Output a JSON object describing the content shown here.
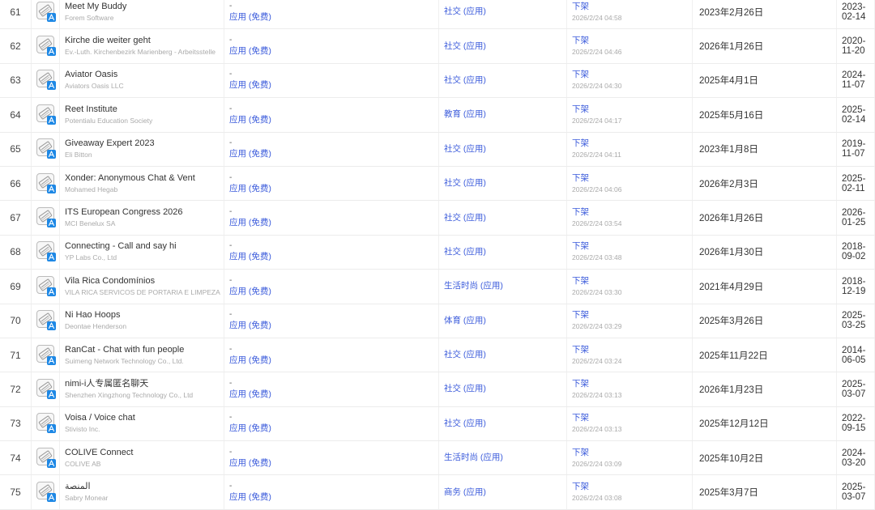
{
  "rows": [
    {
      "rank": "61",
      "name": "Meet My Buddy",
      "developer": "Forem Software",
      "price_dash": "-",
      "price": "应用 (免费)",
      "category": "社交 (应用)",
      "status": "下架",
      "status_time": "2026/2/24 04:58",
      "last_update": "2023年2月26日",
      "release_date": "2023-02-14"
    },
    {
      "rank": "62",
      "name": "Kirche die weiter geht",
      "developer": "Ev.-Luth. Kirchenbezirk Marienberg - Arbeitsstelle",
      "price_dash": "-",
      "price": "应用 (免费)",
      "category": "社交 (应用)",
      "status": "下架",
      "status_time": "2026/2/24 04:46",
      "last_update": "2026年1月26日",
      "release_date": "2020-11-20"
    },
    {
      "rank": "63",
      "name": "Aviator Oasis",
      "developer": "Aviators Oasis LLC",
      "price_dash": "-",
      "price": "应用 (免费)",
      "category": "社交 (应用)",
      "status": "下架",
      "status_time": "2026/2/24 04:30",
      "last_update": "2025年4月1日",
      "release_date": "2024-11-07"
    },
    {
      "rank": "64",
      "name": "Reet Institute",
      "developer": "Potentialu Education Society",
      "price_dash": "-",
      "price": "应用 (免费)",
      "category": "教育 (应用)",
      "status": "下架",
      "status_time": "2026/2/24 04:17",
      "last_update": "2025年5月16日",
      "release_date": "2025-02-14"
    },
    {
      "rank": "65",
      "name": "Giveaway Expert 2023",
      "developer": "Eli Bitton",
      "price_dash": "-",
      "price": "应用 (免费)",
      "category": "社交 (应用)",
      "status": "下架",
      "status_time": "2026/2/24 04:11",
      "last_update": "2023年1月8日",
      "release_date": "2019-11-07"
    },
    {
      "rank": "66",
      "name": "Xonder: Anonymous Chat & Vent",
      "developer": "Mohamed Hegab",
      "price_dash": "-",
      "price": "应用 (免费)",
      "category": "社交 (应用)",
      "status": "下架",
      "status_time": "2026/2/24 04:06",
      "last_update": "2026年2月3日",
      "release_date": "2025-02-11"
    },
    {
      "rank": "67",
      "name": "ITS European Congress 2026",
      "developer": "MCI Benelux SA",
      "price_dash": "-",
      "price": "应用 (免费)",
      "category": "社交 (应用)",
      "status": "下架",
      "status_time": "2026/2/24 03:54",
      "last_update": "2026年1月26日",
      "release_date": "2026-01-25"
    },
    {
      "rank": "68",
      "name": "Connecting - Call and say hi",
      "developer": "YP Labs Co., Ltd",
      "price_dash": "-",
      "price": "应用 (免费)",
      "category": "社交 (应用)",
      "status": "下架",
      "status_time": "2026/2/24 03:48",
      "last_update": "2026年1月30日",
      "release_date": "2018-09-02"
    },
    {
      "rank": "69",
      "name": "Vila Rica Condomínios",
      "developer": "VILA RICA SERVICOS DE PORTARIA E LIMPEZA",
      "price_dash": "-",
      "price": "应用 (免费)",
      "category": "生活时尚 (应用)",
      "status": "下架",
      "status_time": "2026/2/24 03:30",
      "last_update": "2021年4月29日",
      "release_date": "2018-12-19"
    },
    {
      "rank": "70",
      "name": "Ni Hao Hoops",
      "developer": "Deontae Henderson",
      "price_dash": "-",
      "price": "应用 (免费)",
      "category": "体育 (应用)",
      "status": "下架",
      "status_time": "2026/2/24 03:29",
      "last_update": "2025年3月26日",
      "release_date": "2025-03-25"
    },
    {
      "rank": "71",
      "name": "RanCat - Chat with fun people",
      "developer": "Suimeng Network Technology Co., Ltd.",
      "price_dash": "-",
      "price": "应用 (免费)",
      "category": "社交 (应用)",
      "status": "下架",
      "status_time": "2026/2/24 03:24",
      "last_update": "2025年11月22日",
      "release_date": "2014-06-05"
    },
    {
      "rank": "72",
      "name": "nimi-i人专属匿名聊天",
      "developer": "Shenzhen Xingzhong Technology Co., Ltd",
      "price_dash": "-",
      "price": "应用 (免费)",
      "category": "社交 (应用)",
      "status": "下架",
      "status_time": "2026/2/24 03:13",
      "last_update": "2026年1月23日",
      "release_date": "2025-03-07"
    },
    {
      "rank": "73",
      "name": "Voisa / Voice chat",
      "developer": "Stivisto Inc.",
      "price_dash": "-",
      "price": "应用 (免费)",
      "category": "社交 (应用)",
      "status": "下架",
      "status_time": "2026/2/24 03:13",
      "last_update": "2025年12月12日",
      "release_date": "2022-09-15"
    },
    {
      "rank": "74",
      "name": "COLIVE Connect",
      "developer": "COLIVE AB",
      "price_dash": "-",
      "price": "应用 (免费)",
      "category": "生活时尚 (应用)",
      "status": "下架",
      "status_time": "2026/2/24 03:09",
      "last_update": "2025年10月2日",
      "release_date": "2024-03-20"
    },
    {
      "rank": "75",
      "name": "المنصة",
      "developer": "Sabry Monear",
      "price_dash": "-",
      "price": "应用 (免费)",
      "category": "商务 (应用)",
      "status": "下架",
      "status_time": "2026/2/24 03:08",
      "last_update": "2025年3月7日",
      "release_date": "2025-03-07"
    }
  ],
  "icons": {
    "app_placeholder": "broken-image-icon",
    "store_badge": "app-store-icon"
  },
  "colors": {
    "link": "#3b5bdb",
    "store_badge": "#1e88e5",
    "muted": "#aaaaaa"
  }
}
